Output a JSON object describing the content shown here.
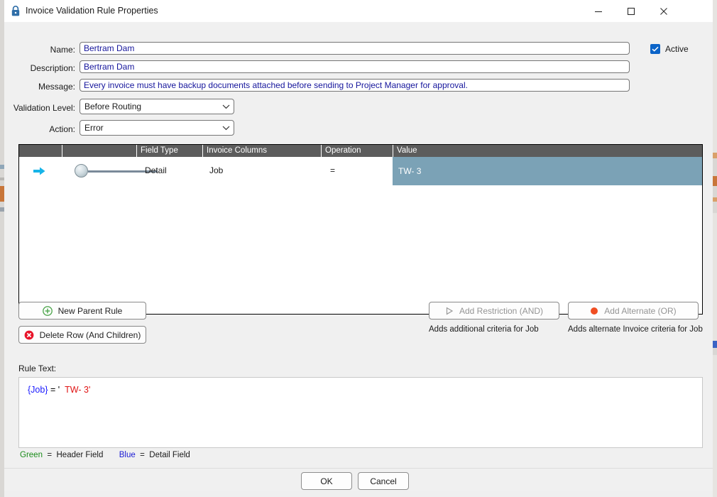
{
  "window": {
    "title": "Invoice Validation Rule Properties",
    "lock_icon": "lock-icon",
    "controls": {
      "minimize": "minimize-icon",
      "maximize": "maximize-icon",
      "close": "close-icon"
    }
  },
  "form": {
    "name_label": "Name:",
    "name_value": "Bertram Dam",
    "description_label": "Description:",
    "description_value": "Bertram Dam",
    "message_label": "Message:",
    "message_value": "Every invoice must have backup documents attached before sending to Project Manager for approval.",
    "validation_level_label": "Validation Level:",
    "validation_level_value": "Before Routing",
    "action_label": "Action:",
    "action_value": "Error",
    "active_label": "Active",
    "active_checked": true
  },
  "grid": {
    "columns": [
      "",
      "",
      "Field Type",
      "Invoice Columns",
      "Operation",
      "Value"
    ],
    "rows": [
      {
        "selected": true,
        "field_type": "Detail",
        "invoice_column": "Job",
        "operation": "=",
        "value": "TW- 3"
      }
    ]
  },
  "buttons": {
    "new_parent_rule": "New Parent Rule",
    "delete_row": "Delete Row (And Children)",
    "add_restriction": "Add Restriction (AND)",
    "add_restriction_hint": "Adds additional criteria for Job",
    "add_alternate": "Add Alternate (OR)",
    "add_alternate_hint": "Adds alternate Invoice criteria for Job",
    "ok": "OK",
    "cancel": "Cancel"
  },
  "rule_text": {
    "label": "Rule Text:",
    "tokens": [
      {
        "text": "{Job}",
        "color": "#1a1aff"
      },
      {
        "text": " = ",
        "color": "#000000"
      },
      {
        "text": "'",
        "color": "#000000"
      },
      {
        "text": "  TW- 3",
        "color": "#e01414"
      },
      {
        "text": "'",
        "color": "#e01414"
      }
    ],
    "token_job": "{Job}",
    "token_eq": "=",
    "token_quote_open": "'",
    "token_value": "TW- 3",
    "token_quote_close": "'"
  },
  "legend": {
    "green_word": "Green",
    "green_eq": "=",
    "green_desc": "Header Field",
    "blue_word": "Blue",
    "blue_eq": "=",
    "blue_desc": "Detail Field"
  },
  "colors": {
    "accent_blue": "#0b64c8",
    "selection": "#7ba2b6",
    "header_bar": "#5c5c5c",
    "green": "#1a8c1a",
    "red": "#e01414"
  }
}
